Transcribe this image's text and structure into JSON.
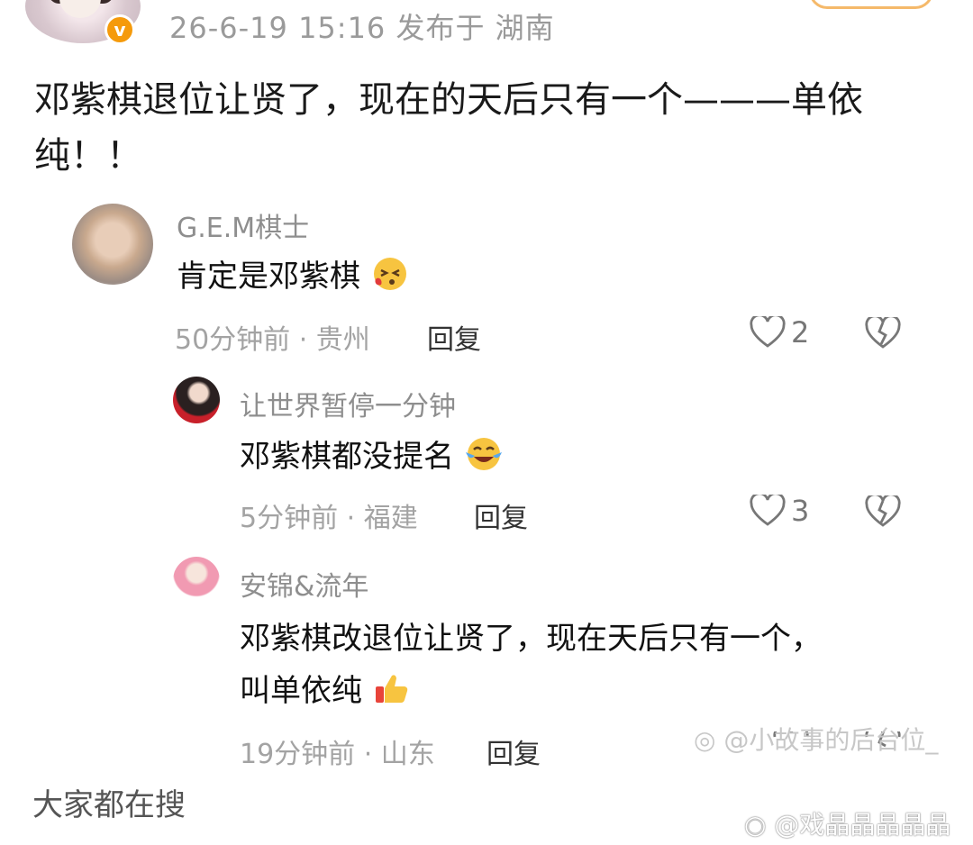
{
  "post": {
    "meta": "26-6-19 15:16  发布于 湖南",
    "text": "邓紫棋退位让贤了，现在的天后只有一个———单依纯！！",
    "verified_icon": "v-badge-icon"
  },
  "comments": [
    {
      "name": "G.E.M棋士",
      "text": "肯定是邓紫棋",
      "emoji": "kiss-face-emoji",
      "meta": "50分钟前 · 贵州",
      "reply_label": "回复",
      "likes": "2"
    },
    {
      "name": "让世界暂停一分钟",
      "text": "邓紫棋都没提名",
      "emoji": "crying-laughing-emoji",
      "meta": "5分钟前 · 福建",
      "reply_label": "回复",
      "likes": "3"
    },
    {
      "name": "安锦&流年",
      "text_line1": "邓紫棋改退位让贤了，现在天后只有一个，",
      "text_line2": "叫单依纯",
      "emoji": "thumbs-up-emoji",
      "meta": "19分钟前 · 山东",
      "reply_label": "回复"
    }
  ],
  "watermarks": {
    "inner": "@小故事的后台位_",
    "outer": "@戏晶晶晶晶晶"
  },
  "footer": {
    "title": "大家都在搜"
  },
  "colors": {
    "badge": "#f59a0b",
    "meta_gray": "#a3a3a3"
  }
}
